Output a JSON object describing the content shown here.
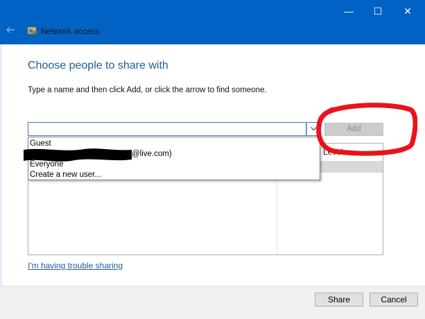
{
  "window": {
    "title": "Network access",
    "controls": {
      "minimize": "—",
      "maximize": "☐",
      "close": "✕"
    }
  },
  "main": {
    "heading": "Choose people to share with",
    "instruction": "Type a name and then click Add, or click the arrow to find someone.",
    "input_value": "",
    "add_label": "Add",
    "level_header": "Level",
    "dropdown_items": [
      "Guest",
      "@live.com)",
      "Everyone",
      "Create a new user..."
    ],
    "trouble_link": "I'm having trouble sharing"
  },
  "footer": {
    "share_label": "Share",
    "cancel_label": "Cancel"
  },
  "colors": {
    "titlebar": "#0062c4",
    "accent_text": "#1d5c99",
    "annotation_red": "#e8141b"
  }
}
